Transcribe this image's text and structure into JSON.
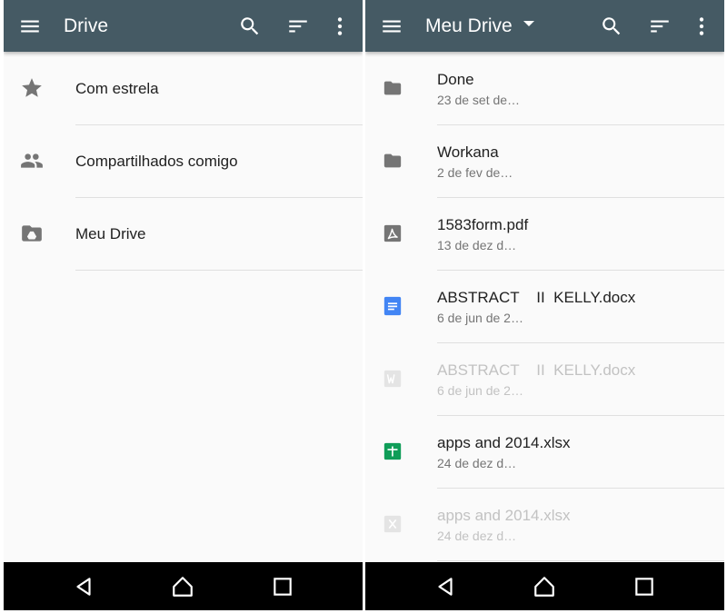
{
  "left_screen": {
    "title": "Drive",
    "items": [
      {
        "label": "Com estrela",
        "icon": "star-icon"
      },
      {
        "label": "Compartilhados comigo",
        "icon": "people-icon"
      },
      {
        "label": "Meu Drive",
        "icon": "drive-folder-icon"
      }
    ]
  },
  "right_screen": {
    "title": "Meu Drive",
    "files": [
      {
        "name": "Done",
        "date": "23 de set de…",
        "icon": "folder-icon",
        "dimmed": false
      },
      {
        "name": "Workana",
        "date": "2 de fev de…",
        "icon": "folder-icon",
        "dimmed": false
      },
      {
        "name": "1583form.pdf",
        "date": "13 de dez d…",
        "icon": "pdf-icon",
        "dimmed": false
      },
      {
        "name": "ABSTRACT    II  KELLY.docx",
        "date": "6 de jun de 2…",
        "icon": "docs-icon",
        "dimmed": false
      },
      {
        "name": "ABSTRACT    II  KELLY.docx",
        "date": "6 de jun de 2…",
        "icon": "word-icon",
        "dimmed": true
      },
      {
        "name": "apps and 2014.xlsx",
        "date": "24 de dez d…",
        "icon": "sheets-icon",
        "dimmed": false
      },
      {
        "name": "apps and 2014.xlsx",
        "date": "24 de dez d…",
        "icon": "excel-icon",
        "dimmed": true
      }
    ]
  },
  "navbar": {
    "buttons": [
      "back-icon",
      "home-icon",
      "recents-icon"
    ]
  },
  "colors": {
    "appbar": "#455a64",
    "background": "#fafafa",
    "navbar": "#000000",
    "docs_blue": "#4285f4",
    "sheets_green": "#0f9d58",
    "icon_gray": "#757575"
  }
}
